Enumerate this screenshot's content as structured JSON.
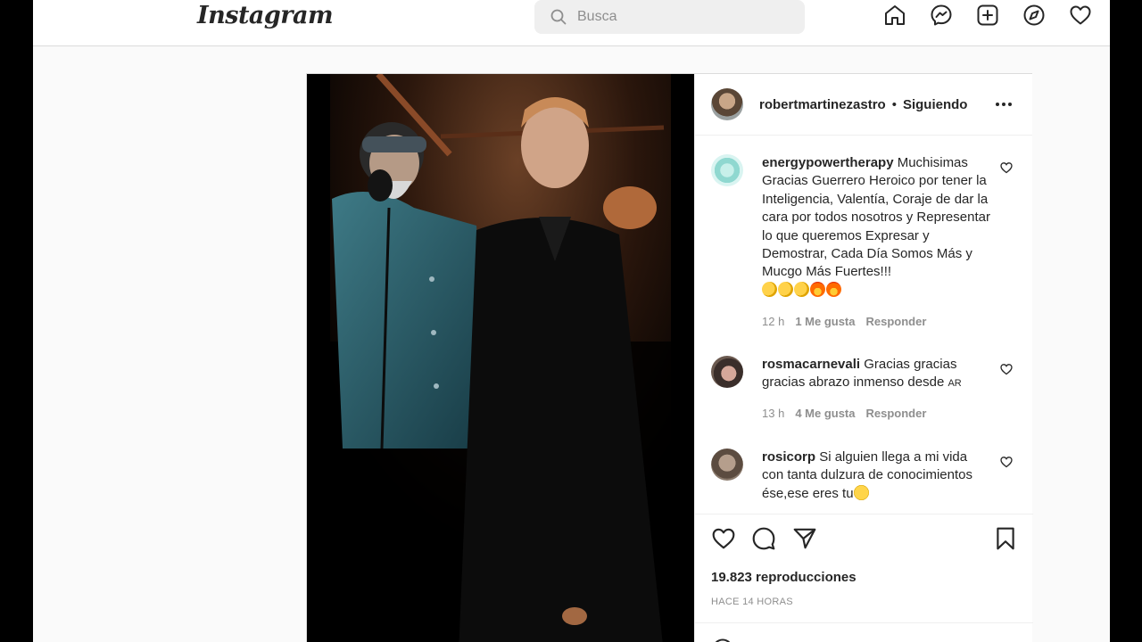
{
  "brand": {
    "logo_text": "Instagram"
  },
  "search": {
    "placeholder": "Busca"
  },
  "nav": {
    "icons": [
      "home-icon",
      "messenger-icon",
      "new-post-icon",
      "explore-icon",
      "activity-heart-icon"
    ]
  },
  "post": {
    "author": "robertmartinezastro",
    "separator": "•",
    "follow_status": "Siguiendo",
    "views": "19.823 reproducciones",
    "time_ago": "HACE 14 HORAS"
  },
  "comments": [
    {
      "username": "energypowertherapy",
      "text": "Muchisimas Gracias Guerrero Heroico por tener la Inteligencia, Valentía, Coraje de dar la cara por todos nosotros y Representar lo que queremos Expresar y Demostrar, Cada Día Somos Más y Mucgo Más Fuertes!!!",
      "emojis": [
        "clap",
        "clap",
        "clap",
        "fire",
        "fire"
      ],
      "age": "12 h",
      "likes": "1 Me gusta",
      "reply": "Responder"
    },
    {
      "username": "rosmacarnevali",
      "text": "Gracias gracias gracias abrazo inmenso desde",
      "flag": "AR",
      "age": "13 h",
      "likes": "4 Me gusta",
      "reply": "Responder"
    },
    {
      "username": "rosicorp",
      "text": "Si alguien llega a mi vida con tanta dulzura de conocimientos ése,ese eres tu",
      "emojis": [
        "smile"
      ]
    }
  ],
  "colors": {
    "text": "#262626",
    "muted": "#8e8e8e",
    "border": "#dbdbdb",
    "search_bg": "#efefef"
  }
}
